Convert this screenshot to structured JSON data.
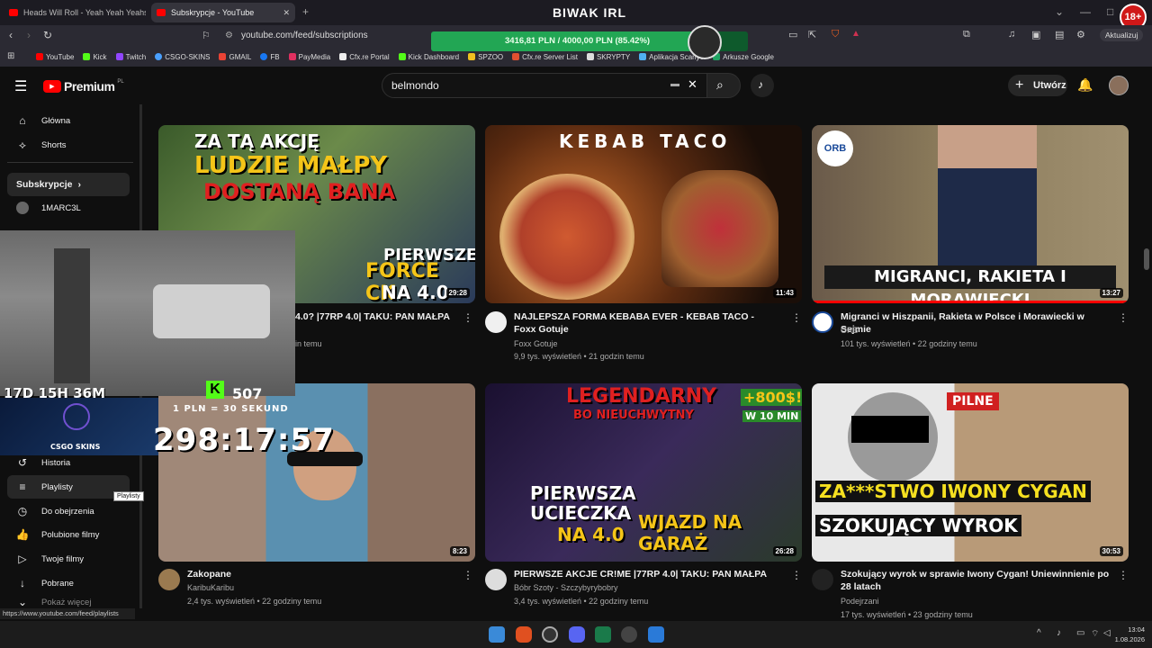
{
  "browser": {
    "window_title": "BIWAK IRL",
    "tabs": [
      {
        "label": "Heads Will Roll - Yeah Yeah Yeahs (Ly"
      },
      {
        "label": "Subskrypcje - YouTube"
      }
    ],
    "url": "youtube.com/feed/subscriptions",
    "update_label": "Aktualizuj",
    "bookmarks": [
      "YouTube",
      "Kick",
      "Twitch",
      "CSGO-SKINS",
      "GMAIL",
      "FB",
      "PayMedia",
      "Cfx.re Portal",
      "Kick Dashboard",
      "SPZOO",
      "Cfx.re Server List",
      "SKRYPTY",
      "Aplikacja Scanye",
      "Arkusze Google"
    ],
    "status_url": "https://www.youtube.com/feed/playlists"
  },
  "overlay": {
    "donation_bar": "3416,81 PLN / 4000,00 PLN (85.42%)",
    "donation_progress": 0.8542,
    "countdown_days": "17D 15H 36M",
    "kick_count": "507",
    "rate_label": "1 PLN = 30 SEKUND",
    "timer": "298:17:57",
    "badge": "18+",
    "sponsor": "CSGO SKINS"
  },
  "youtube": {
    "logo": "Premium",
    "logo_sup": "PL",
    "search_value": "belmondo",
    "create_label": "Utwórz",
    "sidebar": {
      "home": "Główna",
      "shorts": "Shorts",
      "subscriptions_header": "Subskrypcje",
      "channel1": "1MARC3L",
      "history": "Historia",
      "playlists": "Playlisty",
      "watch_later": "Do obejrzenia",
      "liked": "Polubione filmy",
      "your_videos": "Twoje filmy",
      "downloads": "Pobrane",
      "tooltip": "Playlisty",
      "partial_more": "Pokaż więcej"
    },
    "videos": [
      {
        "thumb_text1": "ZA TĄ AKCJĘ",
        "thumb_text2": "LUDZIE MAŁPY",
        "thumb_text3": "DOSTANĄ BANA",
        "thumb_text4": "PIERWSZE",
        "thumb_text5": "FORCE CK",
        "thumb_text6": "NA 4.0",
        "duration": "29:28",
        "title": "4.0? |77RP 4.0| TAKU: PAN MAŁPA",
        "meta": "in temu"
      },
      {
        "thumb_text1": "KEBAB TACO",
        "duration": "11:43",
        "title": "NAJLEPSZA FORMA KEBABA EVER - KEBAB TACO - Foxx Gotuje",
        "channel": "Foxx Gotuje",
        "meta": "9,9 tys. wyświetleń • 21 godzin temu"
      },
      {
        "thumb_text1": "ORB",
        "thumb_text2": "MIGRANCI, RAKIETA I MORAWIECKI",
        "duration": "13:27",
        "title": "Migranci w Hiszpanii, Rakieta w Polsce i Morawiecki w Sejmie",
        "channel": "ORB",
        "meta": "101 tys. wyświetleń • 22 godziny temu"
      },
      {
        "duration": "8:23",
        "title": "Zakopane",
        "channel": "KaribuKaribu",
        "meta": "2,4 tys. wyświetleń • 22 godziny temu"
      },
      {
        "thumb_text1": "LEGENDARNY",
        "thumb_text2": "BO NIEUCHWYTNY",
        "thumb_text3": "+800$!",
        "thumb_text4": "W 10 MIN",
        "thumb_text5": "PIERWSZA",
        "thumb_text6": "UCIECZKA",
        "thumb_text7": "NA 4.0",
        "thumb_text8": "WJAZD NA GARAŻ",
        "duration": "26:28",
        "title": "PIERWSZE AKCJE CR!ME |77RP 4.0| TAKU: PAN MAŁPA",
        "channel": "Bóbr Szoty - Szczybyrybobry",
        "meta": "3,4 tys. wyświetleń • 22 godziny temu"
      },
      {
        "thumb_text1": "PILNE",
        "thumb_text2": "ZA***STWO IWONY CYGAN",
        "thumb_text3": "SZOKUJĄCY WYROK",
        "duration": "30:53",
        "title": "Szokujący wyrok w sprawie Iwony Cygan! Uniewinnienie po 28 latach",
        "channel": "Podejrzani",
        "meta": "17 tys. wyświetleń • 23 godziny temu"
      }
    ]
  },
  "taskbar": {
    "time": "13:04",
    "date": "1.08.2026"
  }
}
